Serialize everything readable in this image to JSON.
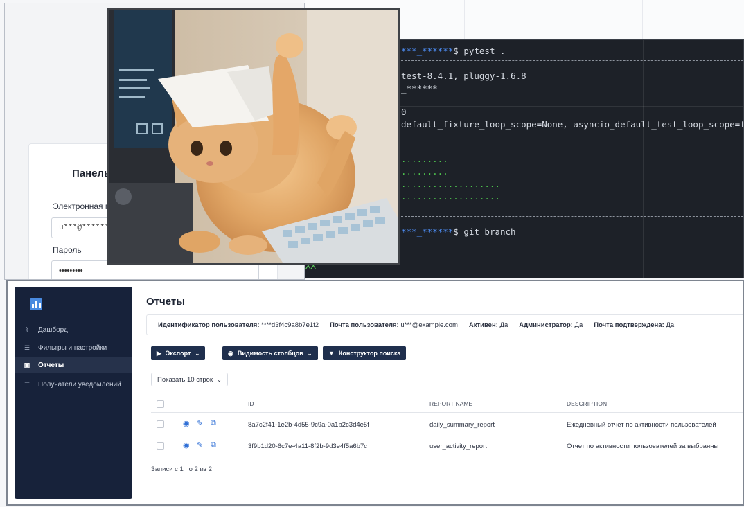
{
  "login": {
    "title": "Панель",
    "email_label": "Электронная п",
    "email_value": "u***@******.",
    "password_label": "Пароль",
    "password_value": "•••••••••"
  },
  "terminal": {
    "prompt1_user": "***_******",
    "prompt1_cmd": "$ pytest .",
    "line_platform": "test-8.4.1, pluggy-1.6.8",
    "line_root": "_******",
    "line_zero": "0",
    "line_config": "default_fixture_loop_scope=None, asyncio_default_test_loop_scope=funct",
    "dots1": ".........",
    "dots2": ".........",
    "dots3": "...................",
    "dots4": "...................",
    "prompt2_user": "***_******",
    "prompt2_cmd": "$ git branch",
    "branch": "XX"
  },
  "app": {
    "nav": [
      {
        "label": "Дашборд",
        "icon": "chart-icon"
      },
      {
        "label": "Фильтры и настройки",
        "icon": "sliders-icon"
      },
      {
        "label": "Отчеты",
        "icon": "report-icon"
      },
      {
        "label": "Получатели уведомлений",
        "icon": "sliders-icon"
      }
    ],
    "page_title": "Отчеты",
    "info": {
      "user_id_label": "Идентификатор пользователя:",
      "user_id_value": "****d3f4c9a8b7e1f2",
      "email_label": "Почта пользователя:",
      "email_value": "u***@example.com",
      "active_label": "Активен:",
      "active_value": "Да",
      "admin_label": "Администратор:",
      "admin_value": "Да",
      "verified_label": "Почта подтверждена:",
      "verified_value": "Да"
    },
    "toolbar": {
      "export": "Экспорт",
      "columns": "Видимость столбцов",
      "search_builder": "Конструктор поиска"
    },
    "rows_select": "Показать 10 строк",
    "columns": [
      "ID",
      "REPORT NAME",
      "DESCRIPTION"
    ],
    "rows": [
      {
        "id": "8a7c2f41-1e2b-4d55-9c9a-0a1b2c3d4e5f",
        "name": "daily_summary_report",
        "description": "Ежедневный отчет по активности пользователей"
      },
      {
        "id": "3f9b1d20-6c7e-4a11-8f2b-9d3e4f5a6b7c",
        "name": "user_activity_report",
        "description": "Отчет по активности пользователей за выбранны"
      }
    ],
    "footer": "Записи с 1 по 2 из 2"
  }
}
